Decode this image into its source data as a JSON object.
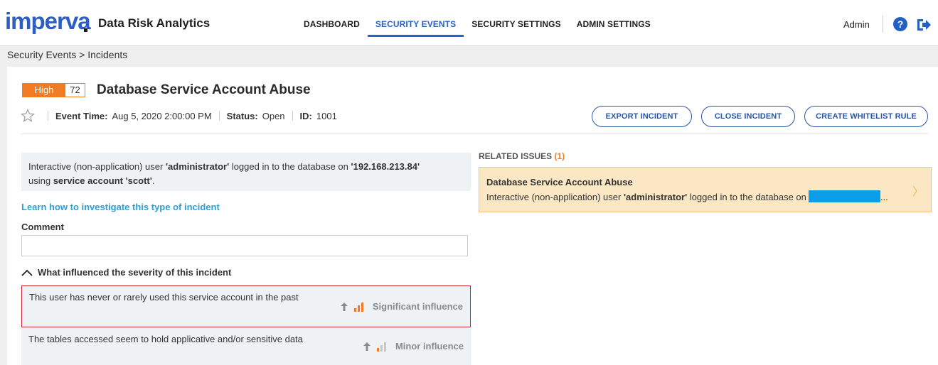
{
  "header": {
    "logo": "imperva",
    "app_title": "Data Risk Analytics",
    "nav": [
      {
        "label": "DASHBOARD",
        "active": false
      },
      {
        "label": "SECURITY EVENTS",
        "active": true
      },
      {
        "label": "SECURITY SETTINGS",
        "active": false
      },
      {
        "label": "ADMIN SETTINGS",
        "active": false
      }
    ],
    "user": "Admin",
    "icons": [
      "help-icon",
      "logout-icon"
    ]
  },
  "breadcrumb": "Security Events > Incidents",
  "incident": {
    "severity_label": "High",
    "severity_score": "72",
    "title": "Database Service Account Abuse",
    "event_time_label": "Event Time:",
    "event_time": "Aug 5, 2020 2:00:00 PM",
    "status_label": "Status:",
    "status": "Open",
    "id_label": "ID:",
    "id": "1001",
    "description": {
      "pre": "Interactive (non-application) user ",
      "user": "'administrator'",
      "mid": " logged in to the database on ",
      "ip": "'192.168.213.84'",
      "line2_pre": "using ",
      "account": "service account 'scott'",
      "end": "."
    },
    "learn_link": "Learn how to investigate this type of incident",
    "comment_label": "Comment",
    "comment_value": "",
    "influence_header": "What influenced the severity of this incident",
    "influences": [
      {
        "text": "This user has never or rarely used this service account in the past",
        "level": "Significant influence",
        "selected": true
      },
      {
        "text": "The tables accessed seem to hold applicative and/or sensitive data",
        "level": "Minor influence",
        "selected": false
      }
    ]
  },
  "actions": {
    "export": "EXPORT INCIDENT",
    "close": "CLOSE INCIDENT",
    "whitelist": "CREATE WHITELIST RULE"
  },
  "related": {
    "header": "RELATED ISSUES",
    "count": "(1)",
    "item": {
      "title": "Database Service Account Abuse",
      "text_pre": "Interactive (non-application) user ",
      "text_user": "'administrator'",
      "text_mid": " logged in to the database on",
      "ellipsis": "..."
    }
  },
  "colors": {
    "brand": "#2d5fc2",
    "accent": "#2563c9",
    "severity_high": "#f07b22",
    "link": "#2a9fd8",
    "selected_border": "#c8242f",
    "related_bg": "#fbe7c4"
  }
}
